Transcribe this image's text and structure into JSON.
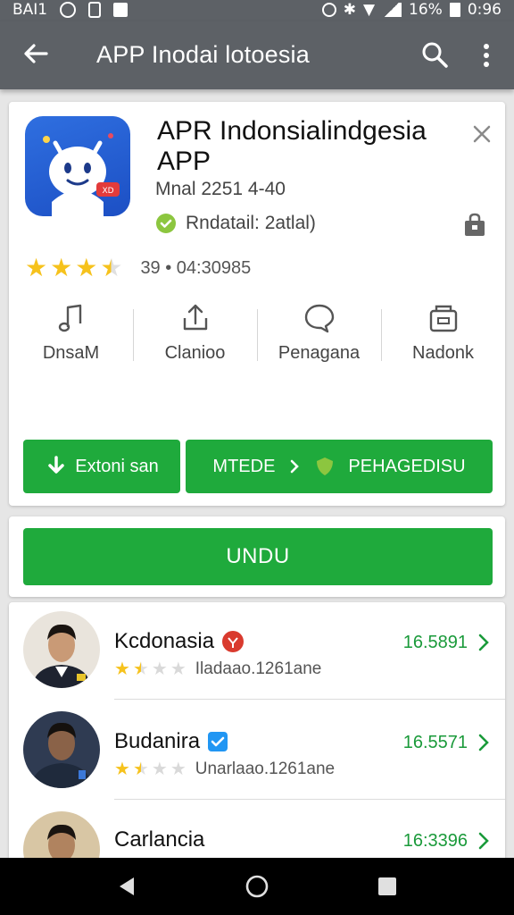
{
  "status_bar": {
    "carrier": "BAI1",
    "battery_pct": "16%",
    "time": "0:96"
  },
  "app_bar": {
    "title": "APP Inodai lotoesia",
    "back_icon": "arrow-back-icon",
    "search_icon": "search-icon",
    "more_icon": "more-vert-icon"
  },
  "app_card": {
    "name": "APR Indonsialindgesia APP",
    "meta": "Mnal 2251 4-40",
    "verified_text": "Rndatail: 2atlal)",
    "rating_text": "39 • 04:30985",
    "rating_stars": 3.5,
    "actions": [
      {
        "label": "DnsaM",
        "icon": "music-note-icon"
      },
      {
        "label": "Clanioo",
        "icon": "share-icon"
      },
      {
        "label": "Penagana",
        "icon": "chat-bubble-icon"
      },
      {
        "label": "Nadonk",
        "icon": "wallet-icon"
      }
    ],
    "button_left": "Extoni san",
    "button_right_a": "MTEDE",
    "button_right_b": "PEHAGEDISU"
  },
  "install_button": "UNDU",
  "list": [
    {
      "name": "Kcdonasia",
      "badge": "red-seal",
      "subtitle": "Iladaao.1261ane",
      "count": "16.5891",
      "stars": 2
    },
    {
      "name": "Budanira",
      "badge": "blue-check",
      "subtitle": "Unarlaao.1261ane",
      "count": "16.5571",
      "stars": 2
    },
    {
      "name": "Carlancia",
      "badge": "",
      "subtitle": "",
      "count": "16:3396",
      "stars": 0
    }
  ],
  "colors": {
    "accent_green": "#1faa3c",
    "count_green": "#1a9a3a",
    "app_bar": "#5d6166",
    "icon_blue": "#1c4fc4"
  }
}
